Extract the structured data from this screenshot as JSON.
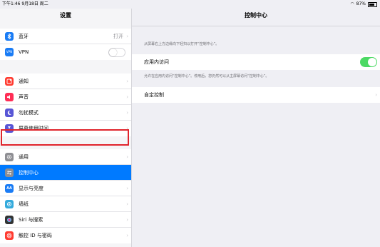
{
  "status": {
    "time": "下午1:46",
    "date": "9月18日 周二",
    "battery": "87%"
  },
  "sidebar": {
    "title": "设置",
    "groups": [
      [
        {
          "label": "蓝牙",
          "value": "打开",
          "icon": "bluetooth-icon",
          "color": "#1a7cf5"
        },
        {
          "label": "VPN",
          "icon": "vpn-icon",
          "color": "#1a7cf5",
          "toggle": false
        }
      ],
      [
        {
          "label": "通知",
          "icon": "notifications-icon",
          "color": "#ff3b30"
        },
        {
          "label": "声音",
          "icon": "sounds-icon",
          "color": "#ff2d55"
        },
        {
          "label": "勿扰模式",
          "icon": "moon-icon",
          "color": "#5856d6"
        },
        {
          "label": "屏幕使用时间",
          "icon": "hourglass-icon",
          "color": "#5856d6"
        }
      ],
      [
        {
          "label": "通用",
          "icon": "gear-icon",
          "color": "#8e8e93"
        },
        {
          "label": "控制中心",
          "icon": "control-center-icon",
          "color": "#8e8e93",
          "selected": true
        },
        {
          "label": "显示与亮度",
          "icon": "display-icon",
          "color": "#1a7cf5"
        },
        {
          "label": "墙纸",
          "icon": "wallpaper-icon",
          "color": "#34aadc"
        },
        {
          "label": "Siri 与搜索",
          "icon": "siri-icon",
          "color": "#333333"
        },
        {
          "label": "触控 ID 与密码",
          "icon": "fingerprint-icon",
          "color": "#ff3b30"
        }
      ]
    ]
  },
  "main": {
    "title": "控制中心",
    "hint_top": "从屏幕右上方边缘向下轻扫以打开“控制中心”。",
    "access_label": "应用内访问",
    "access_on": true,
    "hint_access": "允许在应用内访问“控制中心”。停用后，您仍然可以从主屏幕访问“控制中心”。",
    "customize_label": "自定控制"
  },
  "colors": {
    "accent": "#007aff",
    "toggle_on": "#4cd964",
    "annotation": "#e0242c"
  }
}
